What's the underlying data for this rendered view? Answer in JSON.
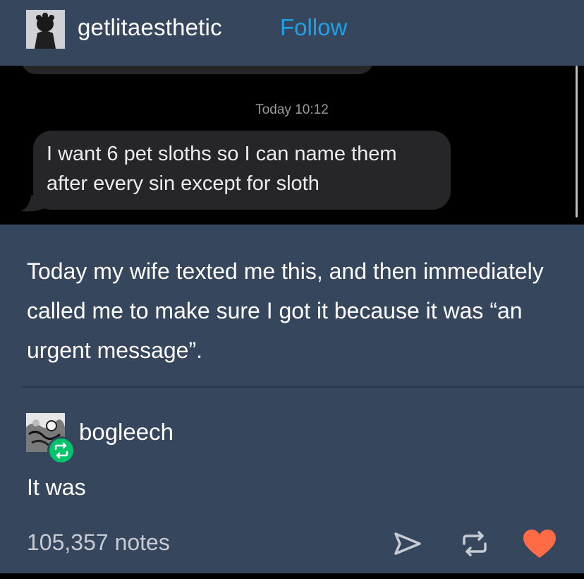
{
  "post": {
    "author": "getlitaesthetic",
    "follow_label": "Follow"
  },
  "screenshot": {
    "timestamp": "Today 10:12",
    "message": "I want 6 pet sloths so I can name them after every sin except for sloth"
  },
  "caption": "Today my wife texted me this, and then immediately called me to make sure I got it because it was “an urgent message”.",
  "reblog": {
    "author": "bogleech",
    "text": "It was"
  },
  "footer": {
    "notes": "105,357 notes",
    "icons": [
      "share-icon",
      "reblog-icon",
      "heart-icon"
    ]
  },
  "colors": {
    "background": "#36465d",
    "follow": "#1fa0e8",
    "heart": "#ff6b45",
    "reblog_badge": "#00c46a",
    "message_bubble": "#262628"
  }
}
